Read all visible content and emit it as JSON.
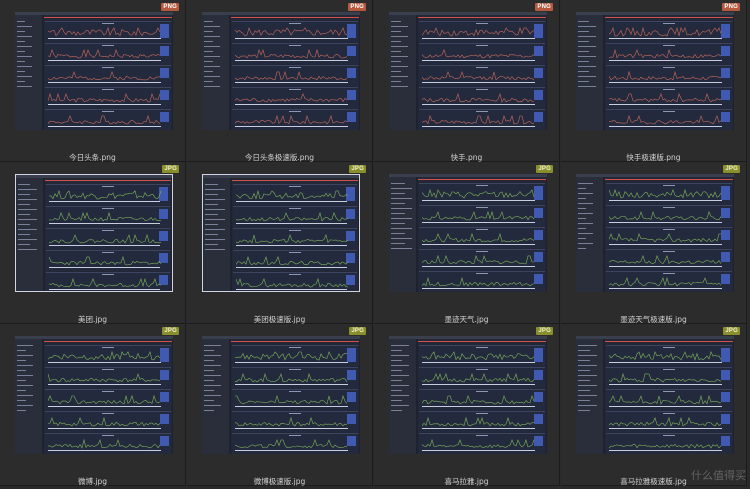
{
  "files": [
    {
      "name": "今日头条.png",
      "badge": "PNG",
      "framed": false,
      "waveColor": "#c96a5b"
    },
    {
      "name": "今日头条极速版.png",
      "badge": "PNG",
      "framed": false,
      "waveColor": "#c96a5b"
    },
    {
      "name": "快手.png",
      "badge": "PNG",
      "framed": false,
      "waveColor": "#c96a5b"
    },
    {
      "name": "快手极速版.png",
      "badge": "PNG",
      "framed": false,
      "waveColor": "#c96a5b"
    },
    {
      "name": "美团.jpg",
      "badge": "JPG",
      "framed": true,
      "waveColor": "#7fb35a"
    },
    {
      "name": "美团极速版.jpg",
      "badge": "JPG",
      "framed": true,
      "waveColor": "#7fb35a"
    },
    {
      "name": "墨迹天气.jpg",
      "badge": "JPG",
      "framed": false,
      "waveColor": "#7fb35a"
    },
    {
      "name": "墨迹天气极速版.jpg",
      "badge": "JPG",
      "framed": false,
      "waveColor": "#7fb35a"
    },
    {
      "name": "微博.jpg",
      "badge": "JPG",
      "framed": false,
      "waveColor": "#7fb35a"
    },
    {
      "name": "微博极速版.jpg",
      "badge": "JPG",
      "framed": false,
      "waveColor": "#7fb35a"
    },
    {
      "name": "喜马拉雅.jpg",
      "badge": "JPG",
      "framed": false,
      "waveColor": "#7fb35a"
    },
    {
      "name": "喜马拉雅极速版.jpg",
      "badge": "JPG",
      "framed": false,
      "waveColor": "#7fb35a"
    }
  ],
  "watermark": "什么值得买",
  "colors": {
    "background": "#2a2a2a",
    "pngBadge": "#b55a3e",
    "jpgBadge": "#8a8f2e"
  }
}
